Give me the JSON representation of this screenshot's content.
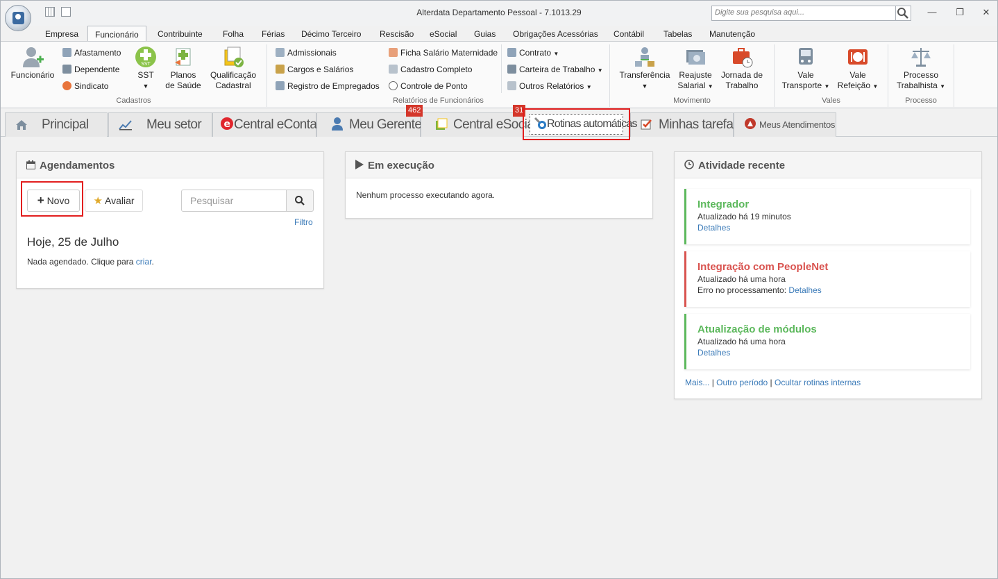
{
  "window": {
    "title": "Alterdata Departamento Pessoal - 7.1013.29",
    "search_placeholder": "Digite sua pesquisa aqui..."
  },
  "menu_tabs": [
    "Empresa",
    "Funcionário",
    "Contribuinte",
    "Folha",
    "Férias",
    "Décimo Terceiro",
    "Rescisão",
    "eSocial",
    "Guias",
    "Obrigações Acessórias",
    "Contábil",
    "Tabelas",
    "Manutenção"
  ],
  "ribbon": {
    "cadastros": {
      "funcionario": "Funcionário",
      "afastamento": "Afastamento",
      "dependente": "Dependente",
      "sindicato": "Sindicato",
      "sst": "SST",
      "planos_1": "Planos",
      "planos_2": "de Saúde",
      "qualif_1": "Qualificação",
      "qualif_2": "Cadastral",
      "label": "Cadastros"
    },
    "relatorios": {
      "admissionais": "Admissionais",
      "cargos": "Cargos e Salários",
      "registro": "Registro de Empregados",
      "ficha": "Ficha Salário Maternidade",
      "cadastro_completo": "Cadastro Completo",
      "controle_ponto": "Controle de Ponto",
      "contrato": "Contrato",
      "carteira": "Carteira de Trabalho",
      "outros": "Outros Relatórios",
      "label": "Relatórios de Funcionários"
    },
    "movimento": {
      "transferencia": "Transferência",
      "reajuste_1": "Reajuste",
      "reajuste_2": "Salarial",
      "jornada_1": "Jornada de",
      "jornada_2": "Trabalho",
      "label": "Movimento"
    },
    "vales": {
      "vt_1": "Vale",
      "vt_2": "Transporte",
      "vr_1": "Vale",
      "vr_2": "Refeição",
      "label": "Vales"
    },
    "processo": {
      "pt_1": "Processo",
      "pt_2": "Trabalhista",
      "label": "Processo"
    }
  },
  "page_tabs": {
    "principal": "Principal",
    "meu_setor": "Meu setor",
    "central_econtador": "Central eContador",
    "meu_gerente": "Meu Gerente",
    "central_esocial": "Central eSocial",
    "rotinas": "Rotinas automáticas",
    "minhas_tarefas": "Minhas tarefas",
    "meus_atendimentos": "Meus Atendimentos",
    "badge_gerente": "462",
    "badge_rotinas": "31"
  },
  "agendamentos": {
    "title": "Agendamentos",
    "novo": "Novo",
    "avaliar": "Avaliar",
    "search_placeholder": "Pesquisar",
    "filtro": "Filtro",
    "date": "Hoje, 25 de Julho",
    "empty_text": "Nada agendado. Clique para ",
    "empty_link": "criar",
    "empty_end": "."
  },
  "execucao": {
    "title": "Em execução",
    "text": "Nenhum processo executando agora."
  },
  "atividade": {
    "title": "Atividade recente",
    "items": [
      {
        "title": "Integrador",
        "updated": "Atualizado há 19 minutos",
        "link": "Detalhes",
        "color": "#5cb85c"
      },
      {
        "title": "Integração com PeopleNet",
        "updated": "Atualizado há uma hora",
        "error_prefix": "Erro no processamento: ",
        "link": "Detalhes",
        "color": "#d9534f"
      },
      {
        "title": "Atualização de módulos",
        "updated": "Atualizado há uma hora",
        "link": "Detalhes",
        "color": "#5cb85c"
      }
    ],
    "footer": {
      "mais": "Mais...",
      "sep": "|",
      "outro": "Outro período",
      "ocultar": "Ocultar rotinas internas"
    }
  }
}
